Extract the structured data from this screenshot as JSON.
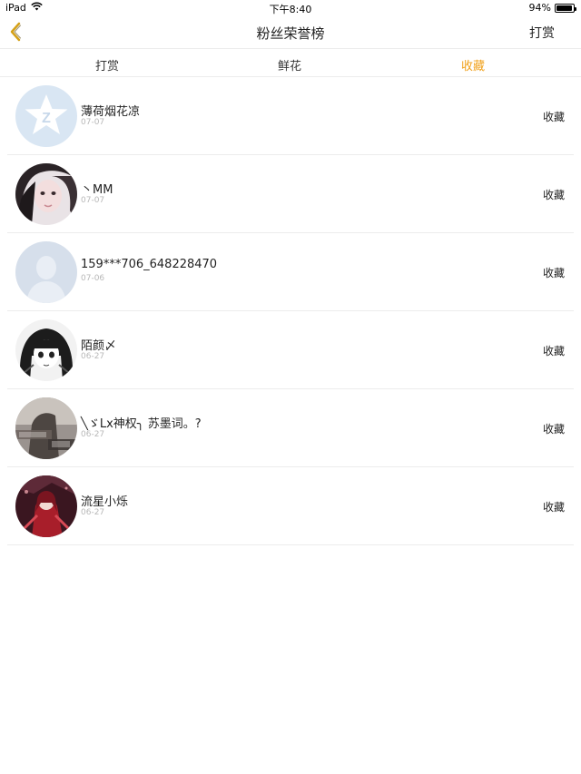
{
  "status_bar": {
    "device": "iPad",
    "time": "下午8:40",
    "battery": "94%",
    "battery_level": 0.94
  },
  "nav": {
    "title": "粉丝荣誉榜",
    "right_button": "打赏",
    "back_icon": "chevron-left-icon"
  },
  "tabs": [
    {
      "label": "打赏",
      "active": false
    },
    {
      "label": "鲜花",
      "active": false
    },
    {
      "label": "收藏",
      "active": true
    }
  ],
  "colors": {
    "accent": "#f0a11c",
    "divider": "#ececec",
    "date_text": "#b8b8b8"
  },
  "rows": [
    {
      "name": "薄荷烟花凉",
      "date": "07-07",
      "action": "收藏",
      "avatar": "qq-default-avatar"
    },
    {
      "name": "丶MM",
      "date": "07-07",
      "action": "收藏",
      "avatar": "photo-avatar"
    },
    {
      "name": "159***706_648228470",
      "date": "07-06",
      "action": "收藏",
      "avatar": "default-person-avatar"
    },
    {
      "name": "陌颜〆",
      "date": "06-27",
      "action": "收藏",
      "avatar": "manga-avatar"
    },
    {
      "name": "╲ゞLx神权╮ 苏墨词。?",
      "date": "06-27",
      "action": "收藏",
      "avatar": "photo-avatar"
    },
    {
      "name": "流星小烁",
      "date": "06-27",
      "action": "收藏",
      "avatar": "illustration-avatar"
    }
  ]
}
